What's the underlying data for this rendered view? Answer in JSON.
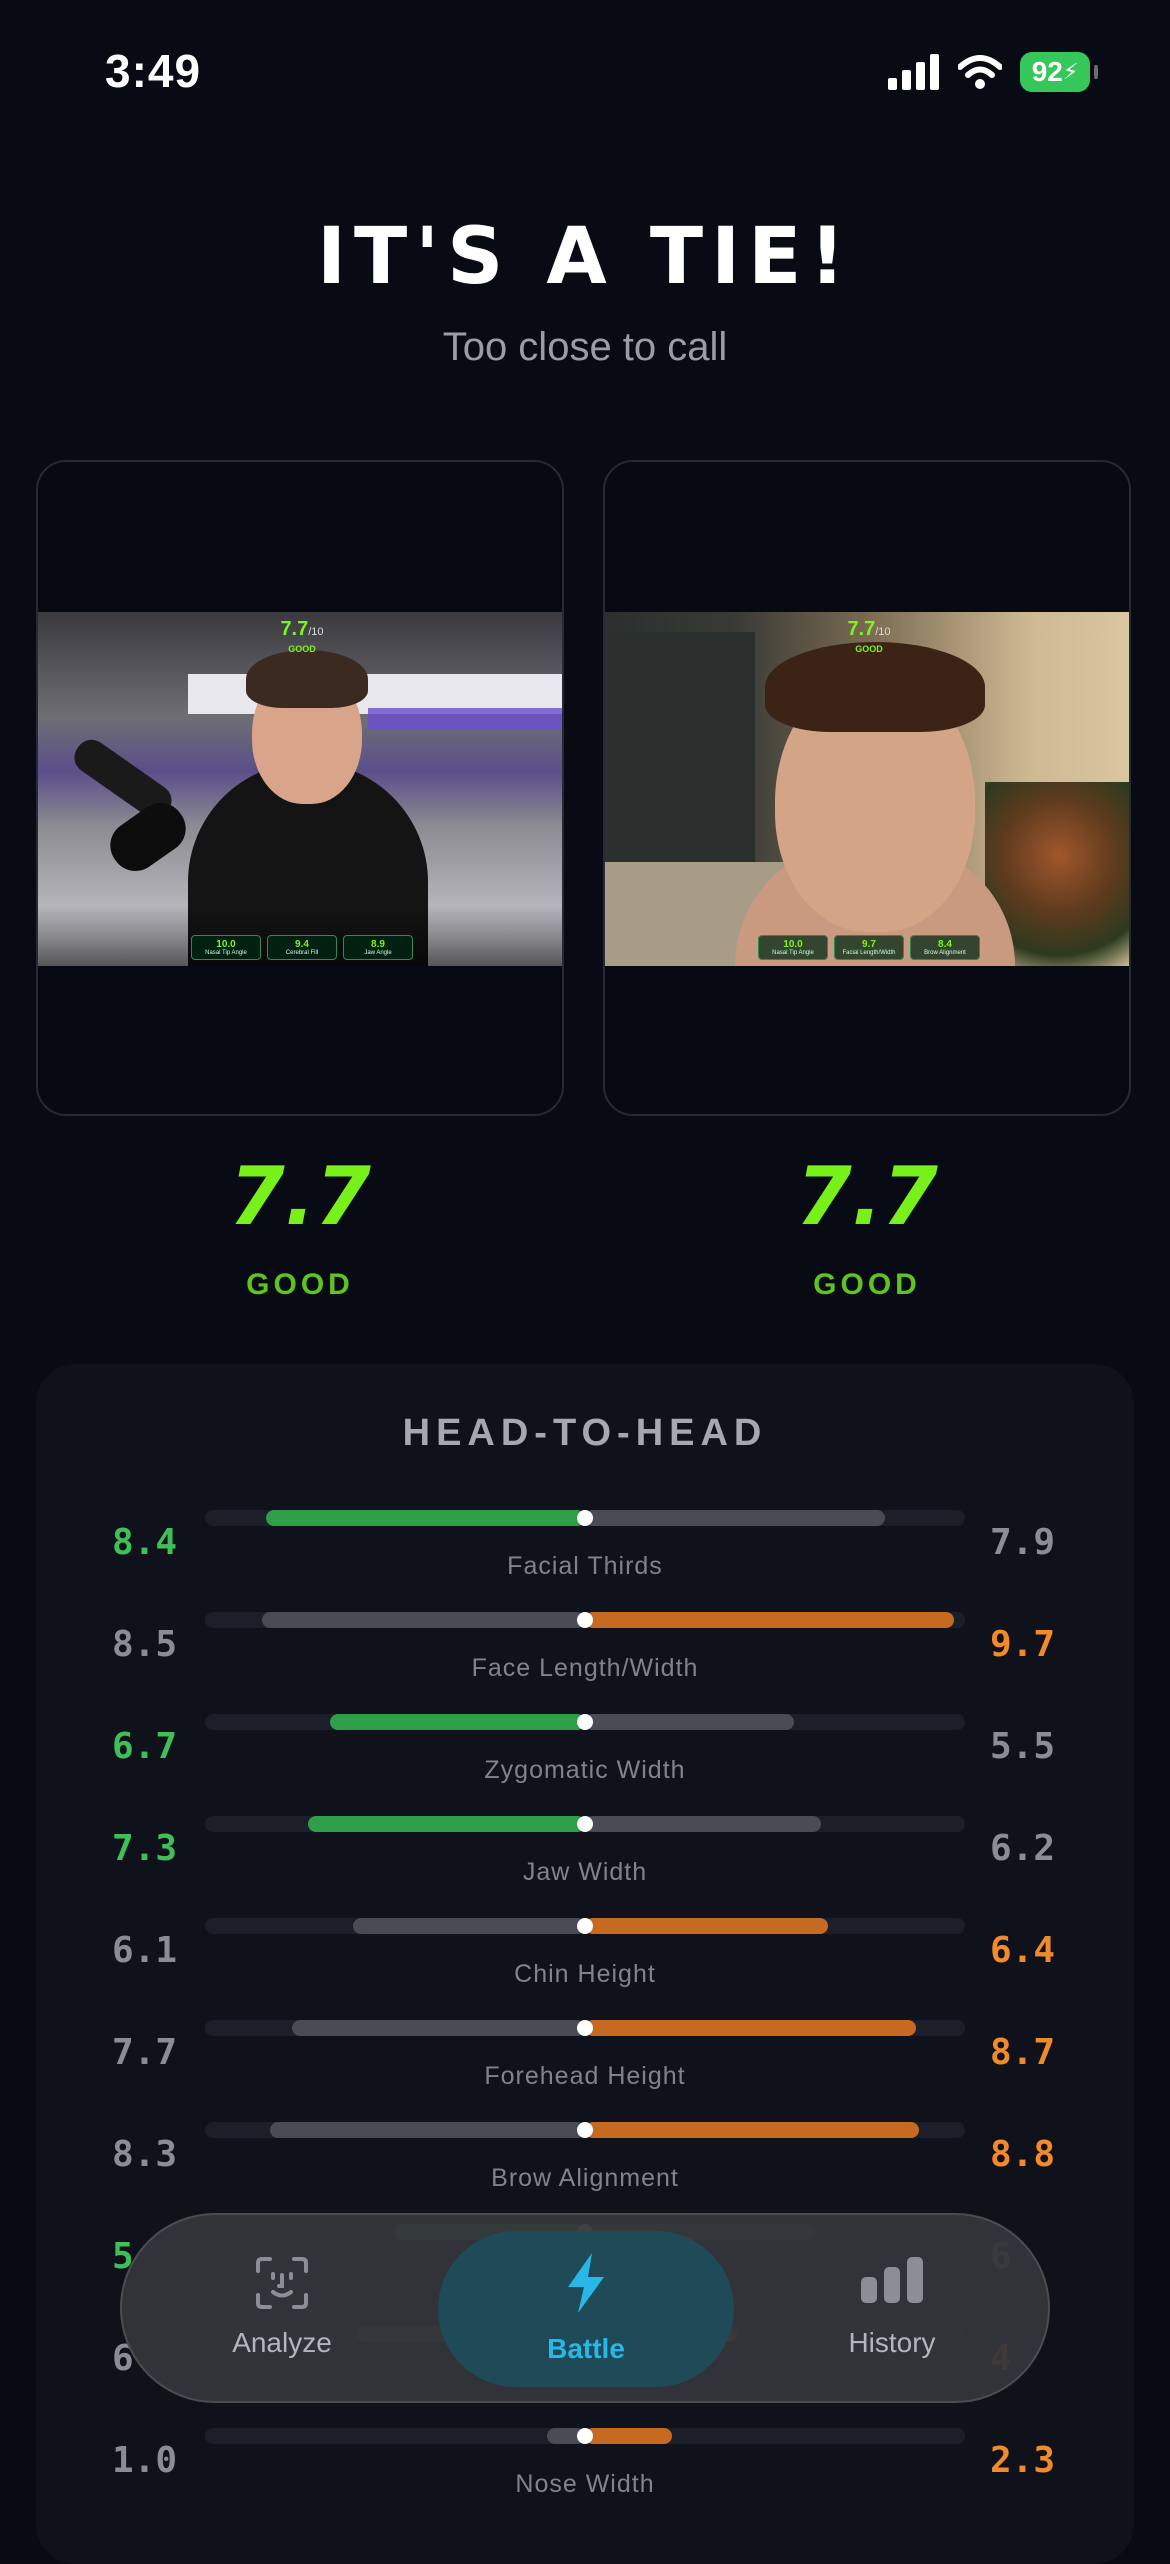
{
  "status_bar": {
    "time": "3:49",
    "battery": "92"
  },
  "header": {
    "title": "IT'S A TIE!",
    "subtitle": "Too close to call"
  },
  "contestants": [
    {
      "overlay_score": "7.7",
      "overlay_max": "/10",
      "overlay_label": "GOOD",
      "mini_metrics": [
        {
          "value": "10.0",
          "label": "Nasal Tip Angle"
        },
        {
          "value": "9.4",
          "label": "Cerebral Fill"
        },
        {
          "value": "8.9",
          "label": "Jaw Angle"
        }
      ],
      "score": "7.7",
      "rating": "GOOD"
    },
    {
      "overlay_score": "7.7",
      "overlay_max": "/10",
      "overlay_label": "GOOD",
      "mini_metrics": [
        {
          "value": "10.0",
          "label": "Nasal Tip Angle"
        },
        {
          "value": "9.7",
          "label": "Facial Length/Width"
        },
        {
          "value": "8.4",
          "label": "Brow Alignment"
        }
      ],
      "score": "7.7",
      "rating": "GOOD"
    }
  ],
  "head_to_head": {
    "title": "HEAD-TO-HEAD",
    "metrics": [
      {
        "name": "Facial Thirds",
        "left": "8.4",
        "right": "7.9",
        "left_value": 8.4,
        "right_value": 7.9,
        "winner": "left"
      },
      {
        "name": "Face Length/Width",
        "left": "8.5",
        "right": "9.7",
        "left_value": 8.5,
        "right_value": 9.7,
        "winner": "right"
      },
      {
        "name": "Zygomatic Width",
        "left": "6.7",
        "right": "5.5",
        "left_value": 6.7,
        "right_value": 5.5,
        "winner": "left"
      },
      {
        "name": "Jaw Width",
        "left": "7.3",
        "right": "6.2",
        "left_value": 7.3,
        "right_value": 6.2,
        "winner": "left"
      },
      {
        "name": "Chin Height",
        "left": "6.1",
        "right": "6.4",
        "left_value": 6.1,
        "right_value": 6.4,
        "winner": "right"
      },
      {
        "name": "Forehead Height",
        "left": "7.7",
        "right": "8.7",
        "left_value": 7.7,
        "right_value": 8.7,
        "winner": "right"
      },
      {
        "name": "Brow Alignment",
        "left": "8.3",
        "right": "8.8",
        "left_value": 8.3,
        "right_value": 8.8,
        "winner": "right"
      },
      {
        "name": "",
        "left": "5",
        "right": "6",
        "left_value": 5,
        "right_value": 6,
        "winner": "left"
      },
      {
        "name": "",
        "left": "6",
        "right": "4",
        "left_value": 6,
        "right_value": 4,
        "winner": "right"
      },
      {
        "name": "Nose Width",
        "left": "1.0",
        "right": "2.3",
        "left_value": 1.0,
        "right_value": 2.3,
        "winner": "right"
      }
    ]
  },
  "tab_bar": {
    "tabs": [
      {
        "label": "Analyze",
        "icon": "face-scan-icon",
        "active": false
      },
      {
        "label": "Battle",
        "icon": "bolt-icon",
        "active": true
      },
      {
        "label": "History",
        "icon": "bar-chart-icon",
        "active": false
      }
    ]
  },
  "colors": {
    "win_left": "#3fbf57",
    "win_right": "#f08a2b",
    "score": "#78f01a",
    "active_tab": "#27b8e8"
  }
}
